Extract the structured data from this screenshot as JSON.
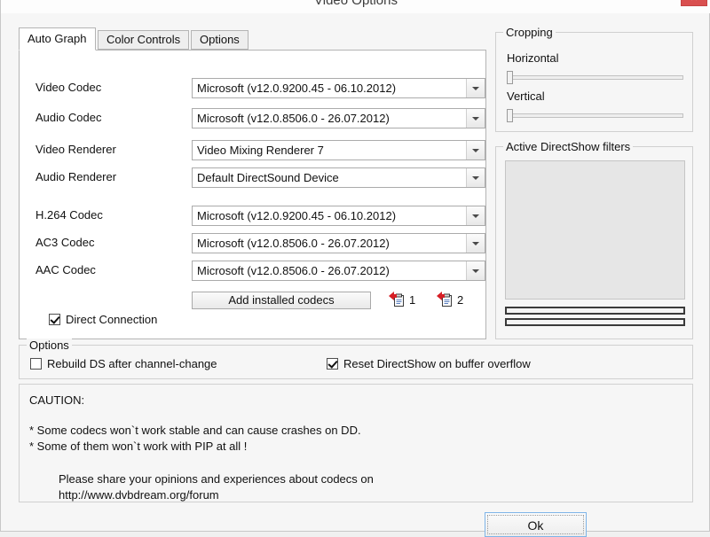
{
  "window": {
    "title": "Video Options",
    "close_label": "✕"
  },
  "tabs": [
    {
      "label": "Auto Graph",
      "active": true
    },
    {
      "label": "Color Controls",
      "active": false
    },
    {
      "label": "Options",
      "active": false
    }
  ],
  "auto_graph": {
    "rows": [
      {
        "label": "Video Codec",
        "value": "Microsoft   (v12.0.9200.45 - 06.10.2012)"
      },
      {
        "label": "Audio Codec",
        "value": "Microsoft   (v12.0.8506.0 - 26.07.2012)"
      },
      {
        "label": "Video Renderer",
        "value": "Video Mixing Renderer 7"
      },
      {
        "label": "Audio Renderer",
        "value": "Default DirectSound Device"
      },
      {
        "label": "H.264 Codec",
        "value": "Microsoft   (v12.0.9200.45 - 06.10.2012)"
      },
      {
        "label": "AC3 Codec",
        "value": "Microsoft   (v12.0.8506.0 - 26.07.2012)"
      },
      {
        "label": "AAC Codec",
        "value": "Microsoft   (v12.0.8506.0 - 26.07.2012)"
      }
    ],
    "add_codecs_label": "Add installed codecs",
    "preset_1_label": "1",
    "preset_2_label": "2",
    "direct_connection": {
      "label": "Direct Connection",
      "checked": true
    }
  },
  "cropping": {
    "title": "Cropping",
    "horizontal_label": "Horizontal",
    "vertical_label": "Vertical",
    "horizontal_value": 0,
    "vertical_value": 0
  },
  "filters": {
    "title": "Active DirectShow filters",
    "items": []
  },
  "options_group": {
    "title": "Options",
    "rebuild": {
      "label": "Rebuild DS after channel-change",
      "checked": false
    },
    "reset": {
      "label": "Reset DirectShow on buffer overflow",
      "checked": true
    }
  },
  "caution": {
    "heading": "CAUTION:",
    "bullets": [
      "*  Some codecs won`t work stable and can cause crashes on DD.",
      "*  Some of them won`t work with PIP at all !"
    ],
    "footer_line1": "Please share your opinions and experiences about codecs on",
    "footer_line2": "http://www.dvbdream.org/forum"
  },
  "footer": {
    "ok_label": "Ok"
  },
  "colors": {
    "accent": "#7eb4e8",
    "close": "#d94f4f",
    "icon_red": "#d61f26"
  }
}
